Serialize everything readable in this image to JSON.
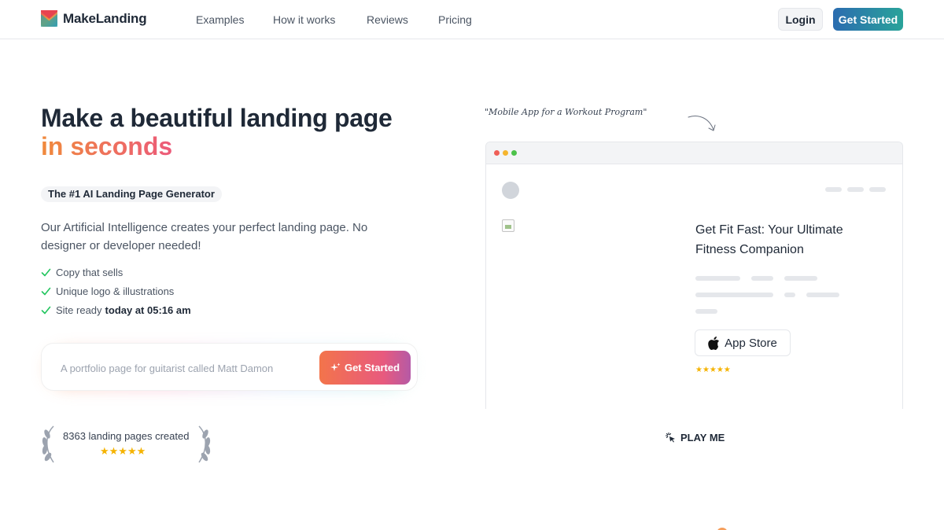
{
  "header": {
    "brand": "MakeLanding",
    "nav": [
      "Examples",
      "How it works",
      "Reviews",
      "Pricing"
    ],
    "login": "Login",
    "get_started": "Get Started"
  },
  "hero": {
    "title": "Make a beautiful landing page",
    "title_accent": "in seconds",
    "tagline": "The #1 AI Landing Page Generator",
    "description": "Our Artificial Intelligence creates your perfect landing page. No designer or developer needed!",
    "features": [
      {
        "text": "Copy that sells",
        "bold": ""
      },
      {
        "text": "Unique logo & illustrations",
        "bold": ""
      },
      {
        "text": "Site ready",
        "bold": "today at 05:16 am"
      }
    ]
  },
  "prompt": {
    "placeholder": "A portfolio page for guitarist called Matt Damon",
    "button": "Get Started"
  },
  "stats": {
    "text": "8363 landing pages created",
    "stars": "★★★★★"
  },
  "preview": {
    "annotation": "\"Mobile App for a Workout Program\"",
    "title": "Get Fit Fast: Your Ultimate Fitness Companion",
    "store_button": "App Store",
    "stars": "★★★★★",
    "play_label": "PLAY ME"
  },
  "colors": {
    "accent_gradient_start": "#f08a3c",
    "accent_gradient_end": "#ec5a7a",
    "header_button_start": "#2b6cb0",
    "header_button_end": "#2aa39a",
    "check": "#22c55e",
    "star": "#f5b301"
  }
}
